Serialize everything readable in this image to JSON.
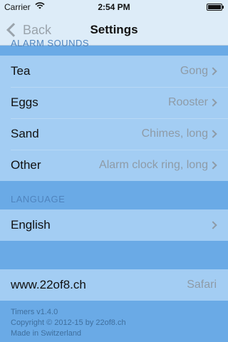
{
  "status_bar": {
    "carrier": "Carrier",
    "wifi_icon": "wifi-icon",
    "time": "2:54 PM",
    "battery_icon": "battery-icon",
    "battery_level_percent": 100
  },
  "nav": {
    "back_label": "Back",
    "back_icon": "chevron-left-icon",
    "title": "Settings"
  },
  "alarm_sounds": {
    "header": "ALARM SOUNDS",
    "items": [
      {
        "label": "Tea",
        "value": "Gong"
      },
      {
        "label": "Eggs",
        "value": "Rooster"
      },
      {
        "label": "Sand",
        "value": "Chimes, long"
      },
      {
        "label": "Other",
        "value": "Alarm clock ring, long"
      }
    ]
  },
  "language": {
    "header": "LANGUAGE",
    "label": "English"
  },
  "website": {
    "label": "www.22of8.ch",
    "value": "Safari"
  },
  "footer": {
    "line1": "Timers v1.4.0",
    "line2": "Copyright © 2012-15 by 22of8.ch",
    "line3": "Made in Switzerland"
  },
  "colors": {
    "background": "#6AAAE6",
    "cell": "#A3CDF3",
    "bar": "#DDECF8",
    "section_header": "#4F84BE",
    "detail_text": "#8E9BA7"
  }
}
